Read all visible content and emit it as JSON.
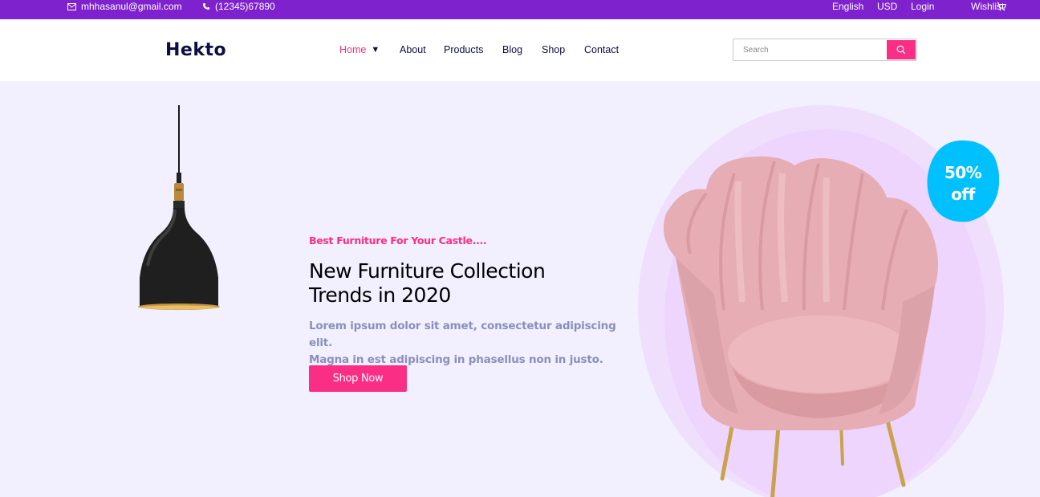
{
  "topbar": {
    "email": "mhhasanul@gmail.com",
    "phone": "(12345)67890",
    "language": "English",
    "currency": "USD",
    "login": "Login",
    "wishlist": "Wishlist",
    "icons": {
      "email": "mail-icon",
      "phone": "phone-icon",
      "cart": "cart-icon"
    }
  },
  "header": {
    "logo": "Hekto",
    "nav": [
      {
        "label": "Home",
        "active": true
      },
      {
        "label": "About"
      },
      {
        "label": "Products"
      },
      {
        "label": "Blog"
      },
      {
        "label": "Shop"
      },
      {
        "label": "Contact"
      }
    ],
    "search": {
      "placeholder": "Search",
      "value": ""
    }
  },
  "hero": {
    "tagline": "Best Furniture For Your Castle....",
    "headline_line1": "New Furniture Collection",
    "headline_line2": "Trends in 2020",
    "description_line1": "Lorem ipsum dolor sit amet, consectetur adipiscing elit.",
    "description_line2": "Magna in est adipiscing in phasellus non in justo.",
    "cta": "Shop Now",
    "badge_line1": "50%",
    "badge_line2": "off"
  },
  "colors": {
    "topbar_bg": "#7E22CE",
    "accent": "#FB2E86",
    "navy": "#0D0E43",
    "hero_bg": "#F2F0FF",
    "muted_text": "#8A8FB9",
    "badge": "#00C1FE"
  }
}
